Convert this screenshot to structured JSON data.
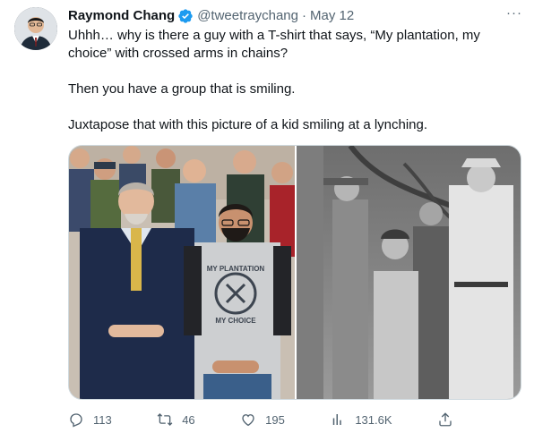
{
  "tweet": {
    "author_name": "Raymond Chang",
    "handle": "@tweetraychang",
    "separator": "·",
    "date": "May 12",
    "more_label": "···",
    "paragraphs": [
      "Uhhh… why is there a guy with a T-shirt that says, “My plantation, my choice” with crossed arms in chains?",
      "Then you have a group that is smiling.",
      "Juxtapose that with this picture of a kid smiling at a lynching."
    ],
    "shirt_lines": [
      "MY PLANTATION",
      "MY CHOICE"
    ]
  },
  "actions": {
    "replies": "113",
    "retweets": "46",
    "likes": "195",
    "views": "131.6K"
  },
  "colors": {
    "text": "#0f1419",
    "secondary": "#536471",
    "verified": "#1d9bf0",
    "border": "#cfd9de"
  },
  "icons": {
    "verified": "verified-badge-icon",
    "reply": "reply-icon",
    "retweet": "retweet-icon",
    "like": "heart-icon",
    "views": "views-icon",
    "share": "share-icon",
    "more": "more-icon"
  }
}
